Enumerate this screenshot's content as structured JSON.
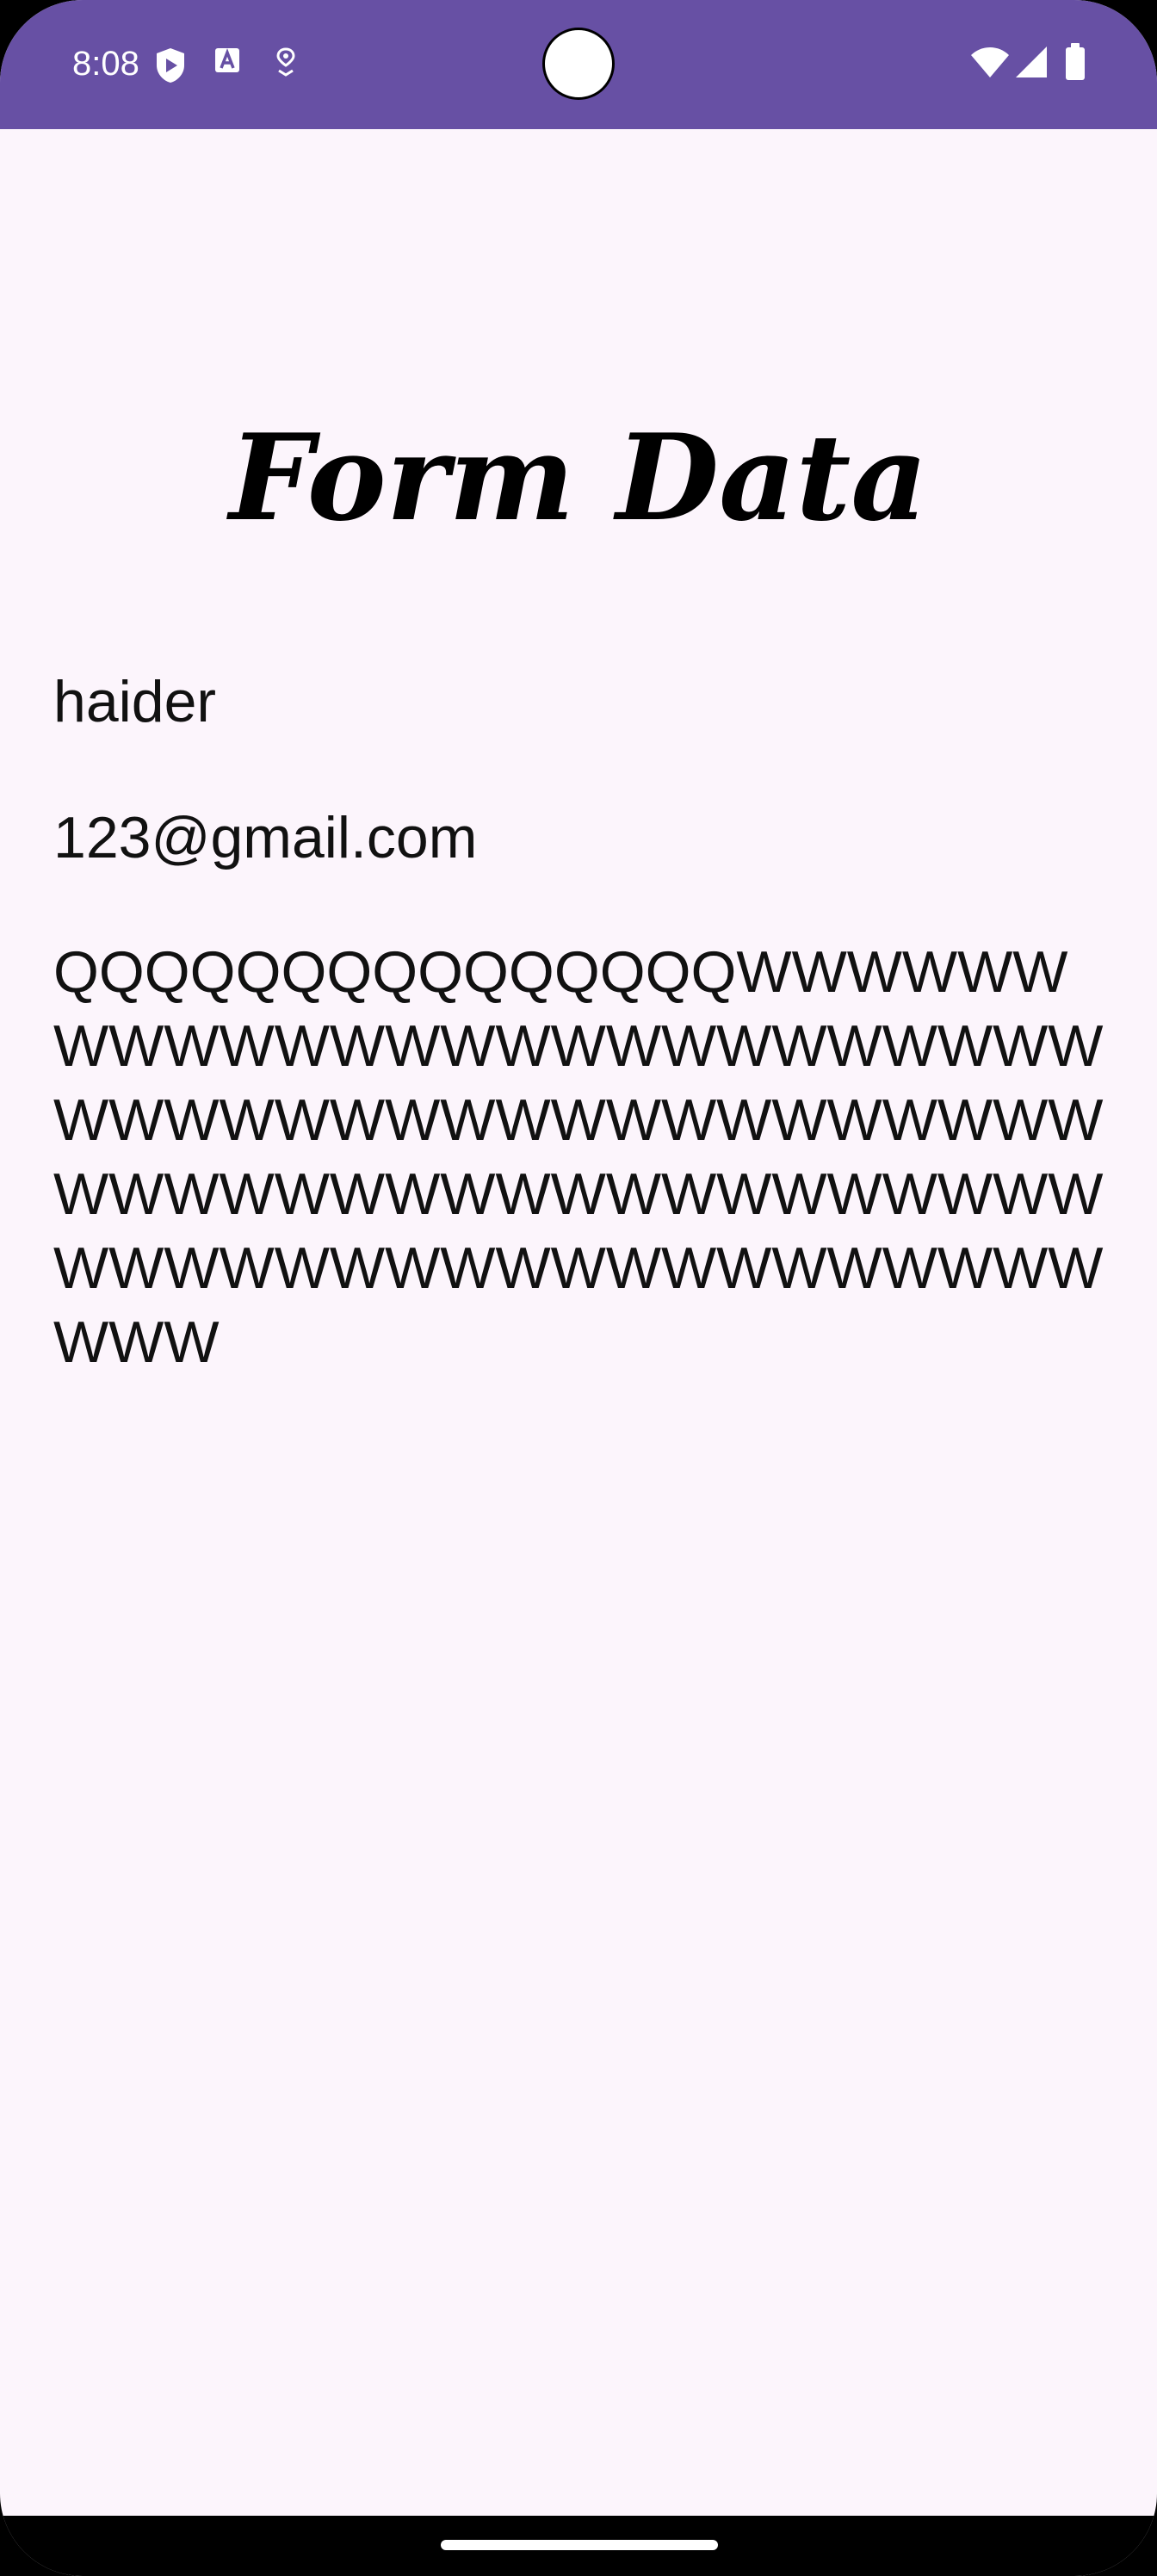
{
  "status_bar": {
    "time": "8:08",
    "icons_left": [
      "shield-play-icon",
      "text-a-icon",
      "location-pin-icon"
    ],
    "icons_right": [
      "wifi-icon",
      "signal-icon",
      "battery-icon"
    ],
    "background_color": "#6750a4"
  },
  "page": {
    "title": "Form Data",
    "background_color": "#fcf5fc"
  },
  "form": {
    "name": "haider",
    "email": "123@gmail.com",
    "message": "QQQQQQQQQQQQQQQWWWWWWWWWWWWWWWWWWWWWWWWWWWWWWWWWWWWWWWWWWWWWWWWWWWWWWWWWWWWWWWWWWWWWWWWWWWWWWWWWWWWW"
  }
}
